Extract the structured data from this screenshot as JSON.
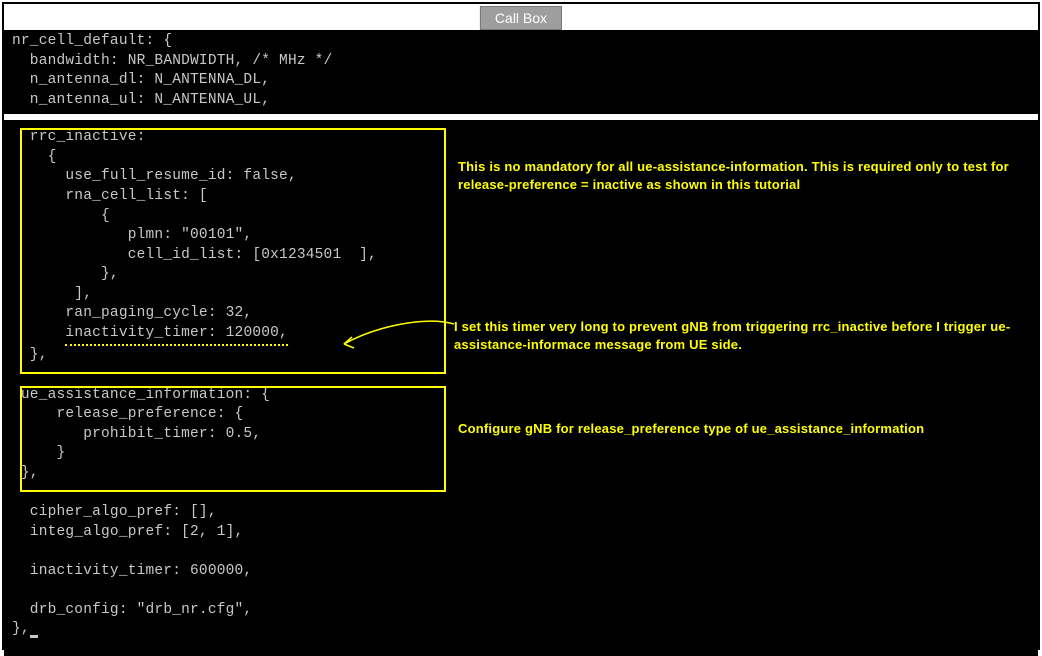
{
  "tab": {
    "label": "Call Box"
  },
  "code_top": {
    "line1": "nr_cell_default: {",
    "line2": "  bandwidth: NR_BANDWIDTH, /* MHz */",
    "line3": "  n_antenna_dl: N_ANTENNA_DL,",
    "line4": "  n_antenna_ul: N_ANTENNA_UL,"
  },
  "code_block1": {
    "l1": "  rrc_inactive:",
    "l2": "    {",
    "l3": "      use_full_resume_id: false,",
    "l4": "      rna_cell_list: [",
    "l5": "          {",
    "l6": "             plmn: \"00101\",",
    "l7": "             cell_id_list: [0x1234501  ],",
    "l8": "          },",
    "l9": "       ],",
    "l10": "      ran_paging_cycle: 32,",
    "l11_prefix": "      ",
    "l11_underlined": "inactivity_timer: 120000,",
    "l12": "  },"
  },
  "code_block2": {
    "l1": " ue_assistance_information: {",
    "l2": "     release_preference: {",
    "l3": "        prohibit_timer: 0.5,",
    "l4": "     }",
    "l5": " },"
  },
  "code_bottom": {
    "l1": "  cipher_algo_pref: [],",
    "l2": "  integ_algo_pref: [2, 1],",
    "l3": "",
    "l4": "  inactivity_timer: 600000,",
    "l5": "",
    "l6": "  drb_config: \"drb_nr.cfg\",",
    "l7": "},"
  },
  "annotations": {
    "a1": "This is no mandatory for all ue-assistance-information. This is required only to test for release-preference = inactive as shown in this tutorial",
    "a2": "I set this timer very long to prevent gNB from triggering rrc_inactive before I trigger ue-assistance-informace message from UE side.",
    "a3": "Configure gNB for release_preference type of ue_assistance_information"
  },
  "colors": {
    "highlight": "#ffff00",
    "code_text": "#c8c8c8",
    "background": "#000000",
    "tab_bg": "#9e9e9e"
  }
}
